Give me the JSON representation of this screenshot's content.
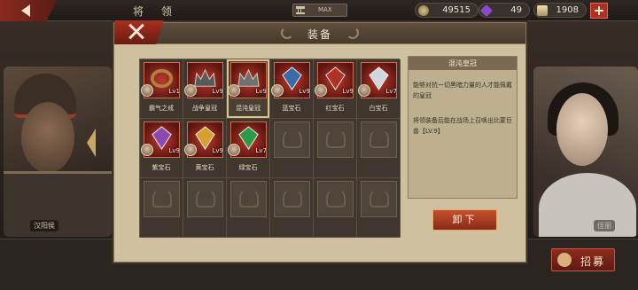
{
  "topbar": {
    "title": "将 领",
    "rank_label": "MAX",
    "resources": {
      "coin": "49515",
      "gem": "49",
      "gold": "1908"
    }
  },
  "background": {
    "left_portrait_label": "汉阳侯",
    "right_portrait_label": "佳丽",
    "recruit_label": "招募"
  },
  "modal": {
    "title": "装备",
    "equipment": [
      {
        "name": "霸气之戒",
        "level": "Lv1",
        "icon": "ring-icon",
        "color": "#b08040"
      },
      {
        "name": "战争皇冠",
        "level": "Lv9",
        "icon": "crown-icon",
        "color": "#5a5a5a"
      },
      {
        "name": "混沌皇冠",
        "level": "Lv9",
        "icon": "crown-icon",
        "color": "#707070"
      },
      {
        "name": "蓝宝石",
        "level": "Lv9",
        "icon": "sapphire-icon",
        "color": "#3a6aa8"
      },
      {
        "name": "红宝石",
        "level": "Lv9",
        "icon": "ruby-icon",
        "color": "#b0302a"
      },
      {
        "name": "白宝石",
        "level": "Lv7",
        "icon": "diamond-icon",
        "color": "#cfd8e0"
      },
      {
        "name": "紫宝石",
        "level": "Lv9",
        "icon": "amethyst-icon",
        "color": "#8a4ab0"
      },
      {
        "name": "黄宝石",
        "level": "Lv9",
        "icon": "topaz-icon",
        "color": "#d8a030"
      },
      {
        "name": "绿宝石",
        "level": "Lv7",
        "icon": "emerald-icon",
        "color": "#2a9a4a"
      }
    ],
    "empty_slot_count": 9,
    "detail": {
      "title": "混沌皇冠",
      "description": "能够对抗一切黑暗力量的人才能佩戴的皇冠",
      "skill": "将领装备后能在战场上召唤出比蒙巨兽【LV.9】"
    },
    "unequip_label": "卸下"
  }
}
